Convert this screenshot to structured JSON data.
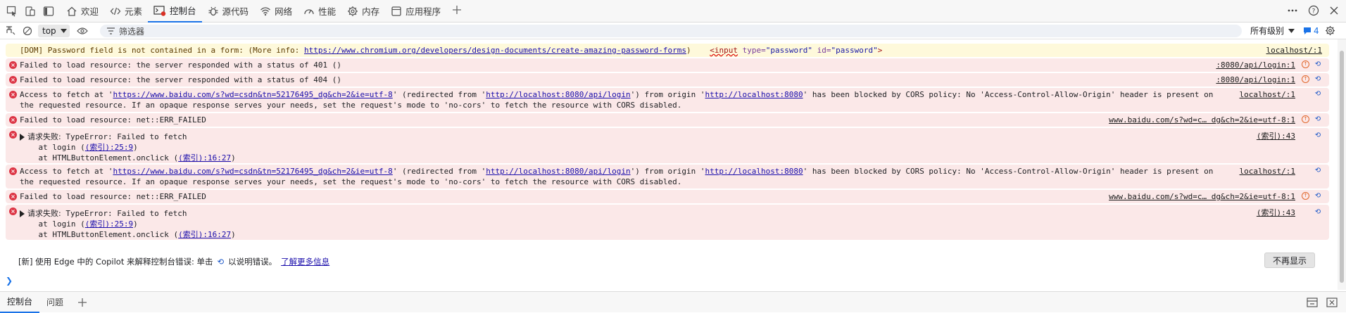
{
  "tabbar": {
    "tabs": [
      {
        "name": "tab-welcome",
        "label": "欢迎",
        "icon": "home-icon"
      },
      {
        "name": "tab-elements",
        "label": "元素",
        "icon": "code-icon"
      },
      {
        "name": "tab-console",
        "label": "控制台",
        "icon": "console-icon",
        "active": true
      },
      {
        "name": "tab-sources",
        "label": "源代码",
        "icon": "bug-icon"
      },
      {
        "name": "tab-network",
        "label": "网络",
        "icon": "wifi-icon"
      },
      {
        "name": "tab-performance",
        "label": "性能",
        "icon": "gauge-icon"
      },
      {
        "name": "tab-memory",
        "label": "内存",
        "icon": "gear-icon"
      },
      {
        "name": "tab-application",
        "label": "应用程序",
        "icon": "window-icon"
      }
    ]
  },
  "toolbar": {
    "context": "top",
    "filter_placeholder": "筛选器",
    "levels": "所有级别",
    "issue_count": "4"
  },
  "messages": {
    "m0": {
      "text": "[DOM] Password field is not contained in a form: (More info: ",
      "link": "https://www.chromium.org/developers/design-documents/create-amazing-password-forms",
      "tail": ")",
      "tag_open": "<input",
      "attr1": "type=",
      "val1": "\"password\"",
      "attr2": "id=",
      "val2": "\"password\"",
      "tag_close": ">",
      "src": "localhost/:1"
    },
    "m1": {
      "text": "Failed to load resource: the server responded with a status of 401 ()",
      "src": ":8080/api/login:1"
    },
    "m2": {
      "text": "Failed to load resource: the server responded with a status of 404 ()",
      "src": ":8080/api/login:1"
    },
    "m3": {
      "p1": "Access to fetch at '",
      "u1": "https://www.baidu.com/s?wd=csdn&tn=52176495_dg&ch=2&ie=utf-8",
      "p2": "' (redirected from '",
      "u2": "http://localhost:8080/api/login",
      "p3": "') from origin '",
      "u3": "http://localhost:8080",
      "p4": "' has been blocked by CORS policy: No 'Access-Control-Allow-Origin' header is present on the requested resource. If an opaque response serves your needs, set the request's mode to 'no-cors' to fetch the resource with CORS disabled.",
      "src": "localhost/:1"
    },
    "m4": {
      "text": "Failed to load resource: net::ERR_FAILED",
      "src": "www.baidu.com/s?wd=c… dg&ch=2&ie=utf-8:1"
    },
    "m5": {
      "head": "请求失败:",
      "text": " TypeError: Failed to fetch",
      "l1a": "    at login (",
      "l1b": "(索引):25:9",
      "l1c": ")",
      "l2a": "    at HTMLButtonElement.onclick (",
      "l2b": "(索引):16:27",
      "l2c": ")",
      "src": "(索引):43"
    },
    "m6": {
      "p1": "Access to fetch at '",
      "u1": "https://www.baidu.com/s?wd=csdn&tn=52176495_dg&ch=2&ie=utf-8",
      "p2": "' (redirected from '",
      "u2": "http://localhost:8080/api/login",
      "p3": "') from origin '",
      "u3": "http://localhost:8080",
      "p4": "' has been blocked by CORS policy: No 'Access-Control-Allow-Origin' header is present on the requested resource. If an opaque response serves your needs, set the request's mode to 'no-cors' to fetch the resource with CORS disabled.",
      "src": "localhost/:1"
    },
    "m7": {
      "text": "Failed to load resource: net::ERR_FAILED",
      "src": "www.baidu.com/s?wd=c… dg&ch=2&ie=utf-8:1"
    },
    "m8": {
      "head": "请求失败:",
      "text": " TypeError: Failed to fetch",
      "l1a": "    at login (",
      "l1b": "(索引):25:9",
      "l1c": ")",
      "l2a": "    at HTMLButtonElement.onclick (",
      "l2b": "(索引):16:27",
      "l2c": ")",
      "src": "(索引):43"
    }
  },
  "copilot": {
    "text1": "[新] 使用 Edge 中的 Copilot 来解释控制台错误: 单击",
    "text2": "以说明错误。",
    "link": "了解更多信息",
    "dismiss": "不再显示"
  },
  "drawer": {
    "tabs": [
      "控制台",
      "问题"
    ]
  }
}
